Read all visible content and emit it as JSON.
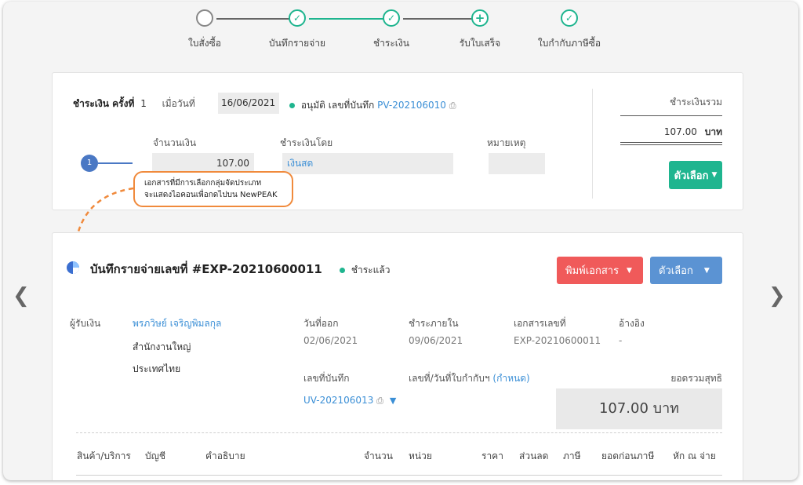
{
  "stepper": {
    "steps": [
      {
        "label": "ใบสั่งซื้อ",
        "state": "empty"
      },
      {
        "label": "บันทึกรายจ่าย",
        "state": "done"
      },
      {
        "label": "ชำระเงิน",
        "state": "done"
      },
      {
        "label": "รับใบเสร็จ",
        "state": "add"
      },
      {
        "label": "ใบกำกับภาษีซื้อ",
        "state": "done"
      }
    ],
    "done_glyph": "✓",
    "add_glyph": "+"
  },
  "payment": {
    "title": "ชำระเงิน ครั้งที่",
    "number": "1",
    "date_label": "เมื่อวันที่",
    "date": "16/06/2021",
    "status_label": "อนุมัติ เลขที่บันทึก",
    "record_no": "PV-202106010",
    "amount_label": "จำนวนเงิน",
    "amount": "107.00",
    "method_label": "ชำระเงินโดย",
    "method": "เงินสด",
    "note_label": "หมายเหตุ",
    "note": "",
    "row_index": "1",
    "total_label": "ชำระเงินรวม",
    "total": "107.00",
    "currency": "บาท",
    "options_label": "ตัวเลือก"
  },
  "tooltip": {
    "line1": "เอกสารที่มีการเลือกกลุ่มจัดประเภท",
    "line2": "จะแสดงไอคอนเพื่อกดไปบน NewPEAK"
  },
  "expense": {
    "title": "บันทึกรายจ่ายเลขที่ #EXP-20210600011",
    "status": "ชำระแล้ว",
    "print_label": "พิมพ์เอกสาร",
    "options_label": "ตัวเลือก",
    "payee_label": "ผู้รับเงิน",
    "payee_name": "พรภวิษย์ เจริญพิมลกุล",
    "payee_branch": "สำนักงานใหญ่",
    "payee_country": "ประเทศไทย",
    "issue_label": "วันที่ออก",
    "issue_date": "02/06/2021",
    "due_label": "ชำระภายใน",
    "due_date": "09/06/2021",
    "docno_label": "เอกสารเลขที่",
    "docno": "EXP-20210600011",
    "ref_label": "อ้างอิง",
    "ref": "-",
    "record_label": "เลขที่บันทึก",
    "record_no": "UV-202106013",
    "taxinv_label": "เลขที่/วันที่ใบกำกับฯ",
    "taxinv_link": "(กำหนด)",
    "net_label": "ยอดรวมสุทธิ",
    "net_total": "107.00 บาท"
  },
  "table": {
    "columns": [
      "สินค้า/บริการ",
      "บัญชี",
      "คำอธิบาย",
      "จำนวน",
      "หน่วย",
      "ราคา",
      "ส่วนลด",
      "ภาษี",
      "ยอดก่อนภาษี",
      "หัก ณ จ่าย"
    ]
  },
  "colors": {
    "green": "#1fb58f",
    "blue": "#3b8fd6",
    "red": "#f05a5a",
    "btn_blue": "#5b93d3",
    "orange": "#f08a3c"
  }
}
